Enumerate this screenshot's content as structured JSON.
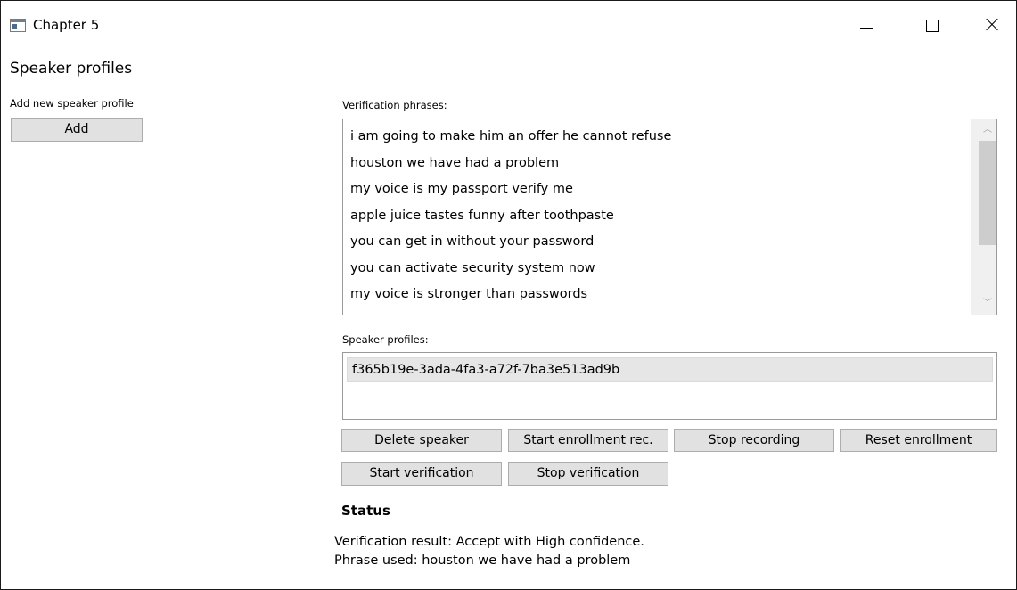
{
  "window": {
    "title": "Chapter 5"
  },
  "page": {
    "title": "Speaker profiles"
  },
  "add_section": {
    "label": "Add new speaker profile",
    "add_button": "Add"
  },
  "phrases": {
    "label": "Verification phrases:",
    "items": [
      "i am going to make him an offer he cannot refuse",
      "houston we have had a problem",
      "my voice is my passport verify me",
      "apple juice tastes funny after toothpaste",
      "you can get in without your password",
      "you can activate security system now",
      "my voice is stronger than passwords"
    ]
  },
  "profiles": {
    "label": "Speaker profiles:",
    "items": [
      "f365b19e-3ada-4fa3-a72f-7ba3e513ad9b"
    ]
  },
  "buttons": {
    "delete_speaker": "Delete speaker",
    "start_enrollment": "Start enrollment rec.",
    "stop_recording": "Stop recording",
    "reset_enrollment": "Reset enrollment",
    "start_verification": "Start verification",
    "stop_verification": "Stop verification"
  },
  "status": {
    "heading": "Status",
    "line1": "Verification result: Accept with High confidence.",
    "line2": "Phrase used: houston we have had a problem"
  },
  "icons": {
    "app": "app-window-icon",
    "minimize": "minimize-icon",
    "maximize": "maximize-icon",
    "close": "close-icon"
  }
}
